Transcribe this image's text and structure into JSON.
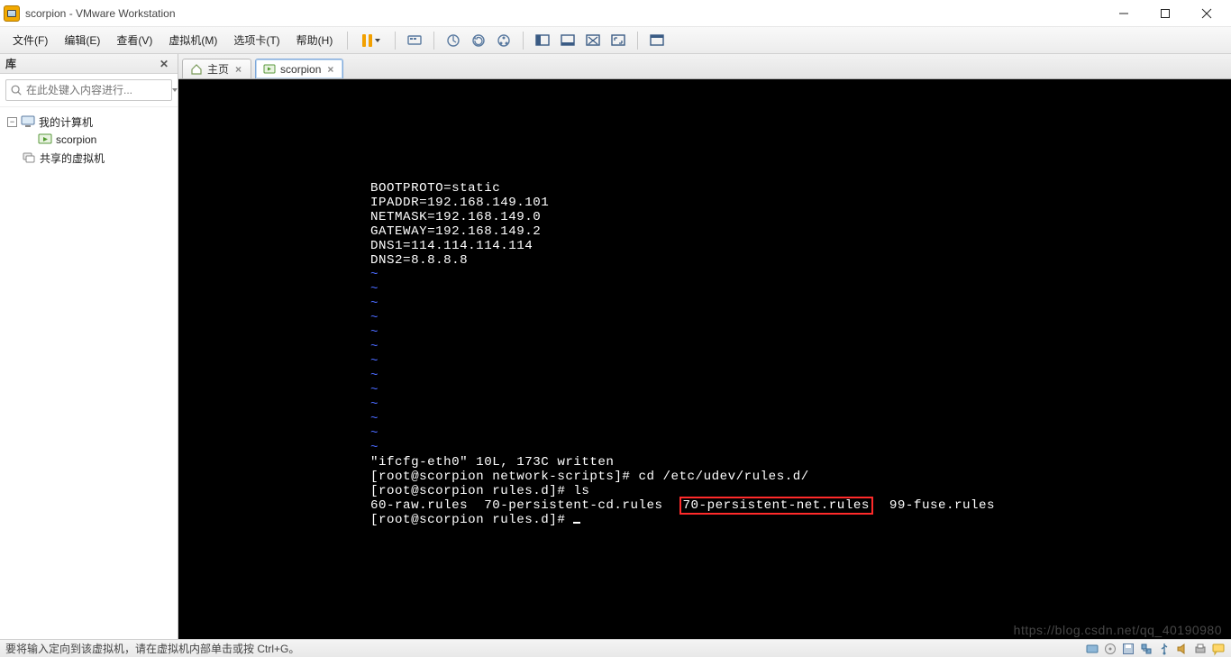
{
  "window": {
    "title": "scorpion - VMware Workstation"
  },
  "menu": {
    "file": "文件(F)",
    "edit": "编辑(E)",
    "view": "查看(V)",
    "vm": "虚拟机(M)",
    "tabs": "选项卡(T)",
    "help": "帮助(H)"
  },
  "sidebar": {
    "title": "库",
    "search_placeholder": "在此处键入内容进行...",
    "tree": {
      "root": {
        "label": "我的计算机",
        "expanded": true
      },
      "child": {
        "label": "scorpion"
      },
      "shared": {
        "label": "共享的虚拟机"
      }
    }
  },
  "tabs": {
    "home": "主页",
    "scorpion": "scorpion"
  },
  "terminal": {
    "l1": "BOOTPROTO=static",
    "l2": "IPADDR=192.168.149.101",
    "l3": "NETMASK=192.168.149.0",
    "l4": "GATEWAY=192.168.149.2",
    "l5": "DNS1=114.114.114.114",
    "l6": "DNS2=8.8.8.8",
    "tilde": "~",
    "l7": "\"ifcfg-eth0\" 10L, 173C written",
    "l8": "[root@scorpion network-scripts]# cd /etc/udev/rules.d/",
    "l9": "[root@scorpion rules.d]# ls",
    "l10a": "60-raw.rules  70-persistent-cd.rules  ",
    "l10b": "70-persistent-net.rules",
    "l10c": "  99-fuse.rules",
    "l11": "[root@scorpion rules.d]# "
  },
  "statusbar": {
    "hint": "要将输入定向到该虚拟机，请在虚拟机内部单击或按 Ctrl+G。"
  },
  "watermark": "https://blog.csdn.net/qq_40190980"
}
